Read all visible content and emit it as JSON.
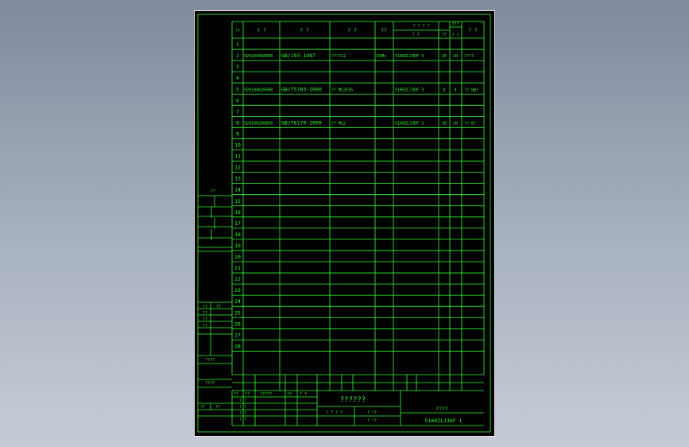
{
  "header": {
    "col_seq": "??",
    "col_code": "? ?",
    "col_std": "? ?",
    "col_name": "? ?",
    "col_material": "??",
    "col_group_top": "? ? ? ?",
    "col_group_sub1": "? ?",
    "col_group_sub2": "??",
    "col_qty_top": "???",
    "col_qty_bottom": "? ?",
    "col_remark": "? ?"
  },
  "rows": [
    {
      "no": "1",
      "code": "",
      "std": "",
      "name": "",
      "mat": "",
      "asm": "",
      "q1": "",
      "q2": "",
      "rem": ""
    },
    {
      "no": "2",
      "code": "92010306005B",
      "std": "GB/193-1987",
      "name": "????12",
      "mat": "65Mn",
      "asm": "5160ZLJ3DF 3",
      "q1": "20",
      "q2": "20",
      "rem": "????"
    },
    {
      "no": "3",
      "code": "",
      "std": "",
      "name": "",
      "mat": "",
      "asm": "",
      "q1": "",
      "q2": "",
      "rem": ""
    },
    {
      "no": "4",
      "code": "",
      "std": "",
      "name": "",
      "mat": "",
      "asm": "",
      "q1": "",
      "q2": "",
      "rem": ""
    },
    {
      "no": "5",
      "code": "92010402050B",
      "std": "GB/T5783-2000",
      "name": "?? M12X35",
      "mat": "",
      "asm": "5160ZLJ3DF 3",
      "q1": "4",
      "q2": "4",
      "rem": "?? 8@?"
    },
    {
      "no": "6",
      "code": "",
      "std": "",
      "name": "",
      "mat": "",
      "asm": "",
      "q1": "",
      "q2": "",
      "rem": ""
    },
    {
      "no": "7",
      "code": "",
      "std": "",
      "name": "",
      "mat": "",
      "asm": "",
      "q1": "",
      "q2": "",
      "rem": ""
    },
    {
      "no": "8",
      "code": "92010020005B",
      "std": "GB/T6170-2000",
      "name": "?? M12",
      "mat": "",
      "asm": "5160ZLJ3DF 3",
      "q1": "20",
      "q2": "20",
      "rem": "?? 8?"
    },
    {
      "no": "9",
      "code": "",
      "std": "",
      "name": "",
      "mat": "",
      "asm": "",
      "q1": "",
      "q2": "",
      "rem": ""
    },
    {
      "no": "10",
      "code": "",
      "std": "",
      "name": "",
      "mat": "",
      "asm": "",
      "q1": "",
      "q2": "",
      "rem": ""
    },
    {
      "no": "11",
      "code": "",
      "std": "",
      "name": "",
      "mat": "",
      "asm": "",
      "q1": "",
      "q2": "",
      "rem": ""
    },
    {
      "no": "12",
      "code": "",
      "std": "",
      "name": "",
      "mat": "",
      "asm": "",
      "q1": "",
      "q2": "",
      "rem": ""
    },
    {
      "no": "13",
      "code": "",
      "std": "",
      "name": "",
      "mat": "",
      "asm": "",
      "q1": "",
      "q2": "",
      "rem": ""
    },
    {
      "no": "14",
      "code": "",
      "std": "",
      "name": "",
      "mat": "",
      "asm": "",
      "q1": "",
      "q2": "",
      "rem": ""
    },
    {
      "no": "15",
      "code": "",
      "std": "",
      "name": "",
      "mat": "",
      "asm": "",
      "q1": "",
      "q2": "",
      "rem": ""
    },
    {
      "no": "16",
      "code": "",
      "std": "",
      "name": "",
      "mat": "",
      "asm": "",
      "q1": "",
      "q2": "",
      "rem": ""
    },
    {
      "no": "17",
      "code": "",
      "std": "",
      "name": "",
      "mat": "",
      "asm": "",
      "q1": "",
      "q2": "",
      "rem": ""
    },
    {
      "no": "18",
      "code": "",
      "std": "",
      "name": "",
      "mat": "",
      "asm": "",
      "q1": "",
      "q2": "",
      "rem": ""
    },
    {
      "no": "19",
      "code": "",
      "std": "",
      "name": "",
      "mat": "",
      "asm": "",
      "q1": "",
      "q2": "",
      "rem": ""
    },
    {
      "no": "20",
      "code": "",
      "std": "",
      "name": "",
      "mat": "",
      "asm": "",
      "q1": "",
      "q2": "",
      "rem": ""
    },
    {
      "no": "21",
      "code": "",
      "std": "",
      "name": "",
      "mat": "",
      "asm": "",
      "q1": "",
      "q2": "",
      "rem": ""
    },
    {
      "no": "22",
      "code": "",
      "std": "",
      "name": "",
      "mat": "",
      "asm": "",
      "q1": "",
      "q2": "",
      "rem": ""
    },
    {
      "no": "23",
      "code": "",
      "std": "",
      "name": "",
      "mat": "",
      "asm": "",
      "q1": "",
      "q2": "",
      "rem": ""
    },
    {
      "no": "24",
      "code": "",
      "std": "",
      "name": "",
      "mat": "",
      "asm": "",
      "q1": "",
      "q2": "",
      "rem": ""
    },
    {
      "no": "25",
      "code": "",
      "std": "",
      "name": "",
      "mat": "",
      "asm": "",
      "q1": "",
      "q2": "",
      "rem": ""
    },
    {
      "no": "26",
      "code": "",
      "std": "",
      "name": "",
      "mat": "",
      "asm": "",
      "q1": "",
      "q2": "",
      "rem": ""
    },
    {
      "no": "27",
      "code": "",
      "std": "",
      "name": "",
      "mat": "",
      "asm": "",
      "q1": "",
      "q2": "",
      "rem": ""
    },
    {
      "no": "28",
      "code": "",
      "std": "",
      "name": "",
      "mat": "",
      "asm": "",
      "q1": "",
      "q2": "",
      "rem": ""
    }
  ],
  "left_strip": {
    "top_label": "??",
    "sig_labels": [
      "??",
      "??",
      "??",
      "??"
    ],
    "sig_labels_right": [
      "??"
    ],
    "bottom_label1": "????",
    "bottom_label2": "????",
    "bottom_label3": "??",
    "bottom_label4": "??"
  },
  "title_block": {
    "labels_row1": [
      "??",
      "??",
      "?????",
      "??",
      "? ?"
    ],
    "left_rows": [
      "? ?",
      "? ?",
      "? ?",
      "? ?"
    ],
    "drawing_name": "??????",
    "sub_label1": "? ? ? ?",
    "sub_label2": "? !?",
    "sub_label3": "? !?",
    "company_label": "????",
    "drawing_no": "5160ZLJ3DF 1"
  },
  "colors": {
    "line": "#33ff33",
    "border": "#ffffff",
    "bg": "#000000"
  }
}
